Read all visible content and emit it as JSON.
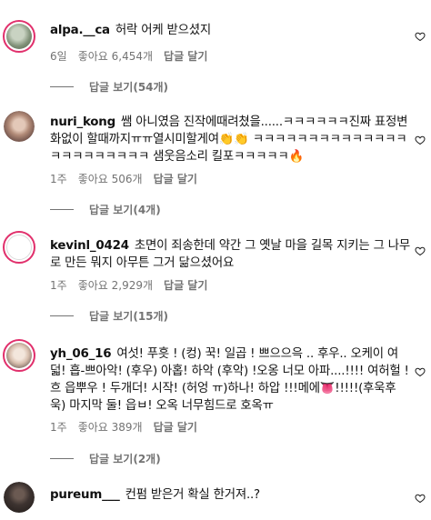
{
  "comments": [
    {
      "username": "alpa.__ca",
      "text": "허락 어케 받으셨지",
      "time": "6일",
      "likes": "좋아요 6,454개",
      "reply": "답글 달기",
      "view_replies": "답글 보기(54개)",
      "avatar_color": "#a8b6a0"
    },
    {
      "username": "nuri_kong",
      "text": "쌤 아니였음 진작에때려쳤을......ㅋㅋㅋㅋㅋㅋ진짜 표정변화없이 할때까지ㅠㅠ열시미할게여👏👏 ㅋㅋㅋㅋㅋㅋㅋㅋㅋㅋㅋㅋㅋㅋㅋㅋㅋㅋㅋㅋㅋㅋㅋ 샘웃음소리 킬포ㅋㅋㅋㅋㅋ🔥",
      "time": "1주",
      "likes": "좋아요 506개",
      "reply": "답글 달기",
      "view_replies": "답글 보기(4개)",
      "avatar_color": "#b89a8a"
    },
    {
      "username": "kevinl_0424",
      "text": "초면이 죄송한데 약간 그 옛날 마을 길목 지키는 그 나무로 만든 뭐지 아무튼 그거 닮으셨어요",
      "time": "1주",
      "likes": "좋아요 2,929개",
      "reply": "답글 달기",
      "view_replies": "답글 보기(15개)",
      "avatar_color": "#ffffff"
    },
    {
      "username": "yh_06_16",
      "text": "여섯! 푸흣 ! (컹) 꾹! 일곱 ! 쁘으으윽 .. 후우.. 오케이 여덟! 흡-쁘아악! (후우) 아홉! 하악 (후악) !오옹 너모 아파....!!!! 여허헐 ! 흐 읍뿌우 ! 두개더! 시작! (허엉 ㅠ)하나! 하압 !!!메에👅!!!!!(후욱후욱) 마지막 둘! 읍ㅂ! 오옥 너무힘드로 호옥ㅠ",
      "time": "1주",
      "likes": "좋아요 389개",
      "reply": "답글 달기",
      "view_replies": "답글 보기(2개)",
      "avatar_color": "#e8d6c8"
    },
    {
      "username": "pureum___",
      "text": "컨펌 받은거 확실 한거져..?",
      "avatar_color": "#3a3230"
    }
  ],
  "icons": {
    "like": "heart-outline-icon"
  },
  "colors": {
    "story_ring": "#e1306c",
    "meta": "#737373"
  }
}
